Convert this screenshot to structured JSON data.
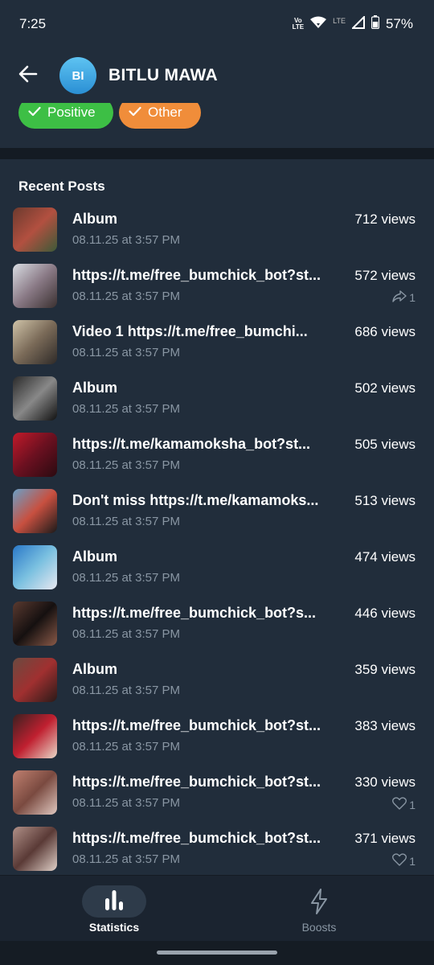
{
  "status_bar": {
    "time": "7:25",
    "volte_top": "Vo",
    "volte_bottom": "LTE",
    "lte": "LTE",
    "battery": "57%"
  },
  "header": {
    "avatar_initials": "BI",
    "title": "BITLU MAWA",
    "avatar_color": "#3aa6e4"
  },
  "chips": [
    {
      "label": "Positive",
      "color": "#3dbf45"
    },
    {
      "label": "Other",
      "color": "#f08d3a"
    }
  ],
  "recent_posts": {
    "title": "Recent Posts",
    "items": [
      {
        "title": "Album",
        "date": "08.11.25 at 3:57 PM",
        "views": "712 views",
        "meta": "",
        "meta_icon": ""
      },
      {
        "title": "https://t.me/free_bumchick_bot?st...",
        "date": "08.11.25 at 3:57 PM",
        "views": "572 views",
        "meta": "1",
        "meta_icon": "share-icon"
      },
      {
        "title": "Video 1  https://t.me/free_bumchi...",
        "date": "08.11.25 at 3:57 PM",
        "views": "686 views",
        "meta": "",
        "meta_icon": ""
      },
      {
        "title": "Album",
        "date": "08.11.25 at 3:57 PM",
        "views": "502 views",
        "meta": "",
        "meta_icon": ""
      },
      {
        "title": "https://t.me/kamamoksha_bot?st...",
        "date": "08.11.25 at 3:57 PM",
        "views": "505 views",
        "meta": "",
        "meta_icon": ""
      },
      {
        "title": "Don't miss  https://t.me/kamamoks...",
        "date": "08.11.25 at 3:57 PM",
        "views": "513 views",
        "meta": "",
        "meta_icon": ""
      },
      {
        "title": "Album",
        "date": "08.11.25 at 3:57 PM",
        "views": "474 views",
        "meta": "",
        "meta_icon": ""
      },
      {
        "title": "https://t.me/free_bumchick_bot?s...",
        "date": "08.11.25 at 3:57 PM",
        "views": "446 views",
        "meta": "",
        "meta_icon": ""
      },
      {
        "title": "Album",
        "date": "08.11.25 at 3:57 PM",
        "views": "359 views",
        "meta": "",
        "meta_icon": ""
      },
      {
        "title": "https://t.me/free_bumchick_bot?st...",
        "date": "08.11.25 at 3:57 PM",
        "views": "383 views",
        "meta": "",
        "meta_icon": ""
      },
      {
        "title": "https://t.me/free_bumchick_bot?st...",
        "date": "08.11.25 at 3:57 PM",
        "views": "330 views",
        "meta": "1",
        "meta_icon": "heart-icon"
      },
      {
        "title": "https://t.me/free_bumchick_bot?st...",
        "date": "08.11.25 at 3:57 PM",
        "views": "371 views",
        "meta": "1",
        "meta_icon": "heart-icon"
      }
    ]
  },
  "bottom_nav": {
    "statistics_label": "Statistics",
    "boosts_label": "Boosts",
    "active": "Statistics"
  }
}
